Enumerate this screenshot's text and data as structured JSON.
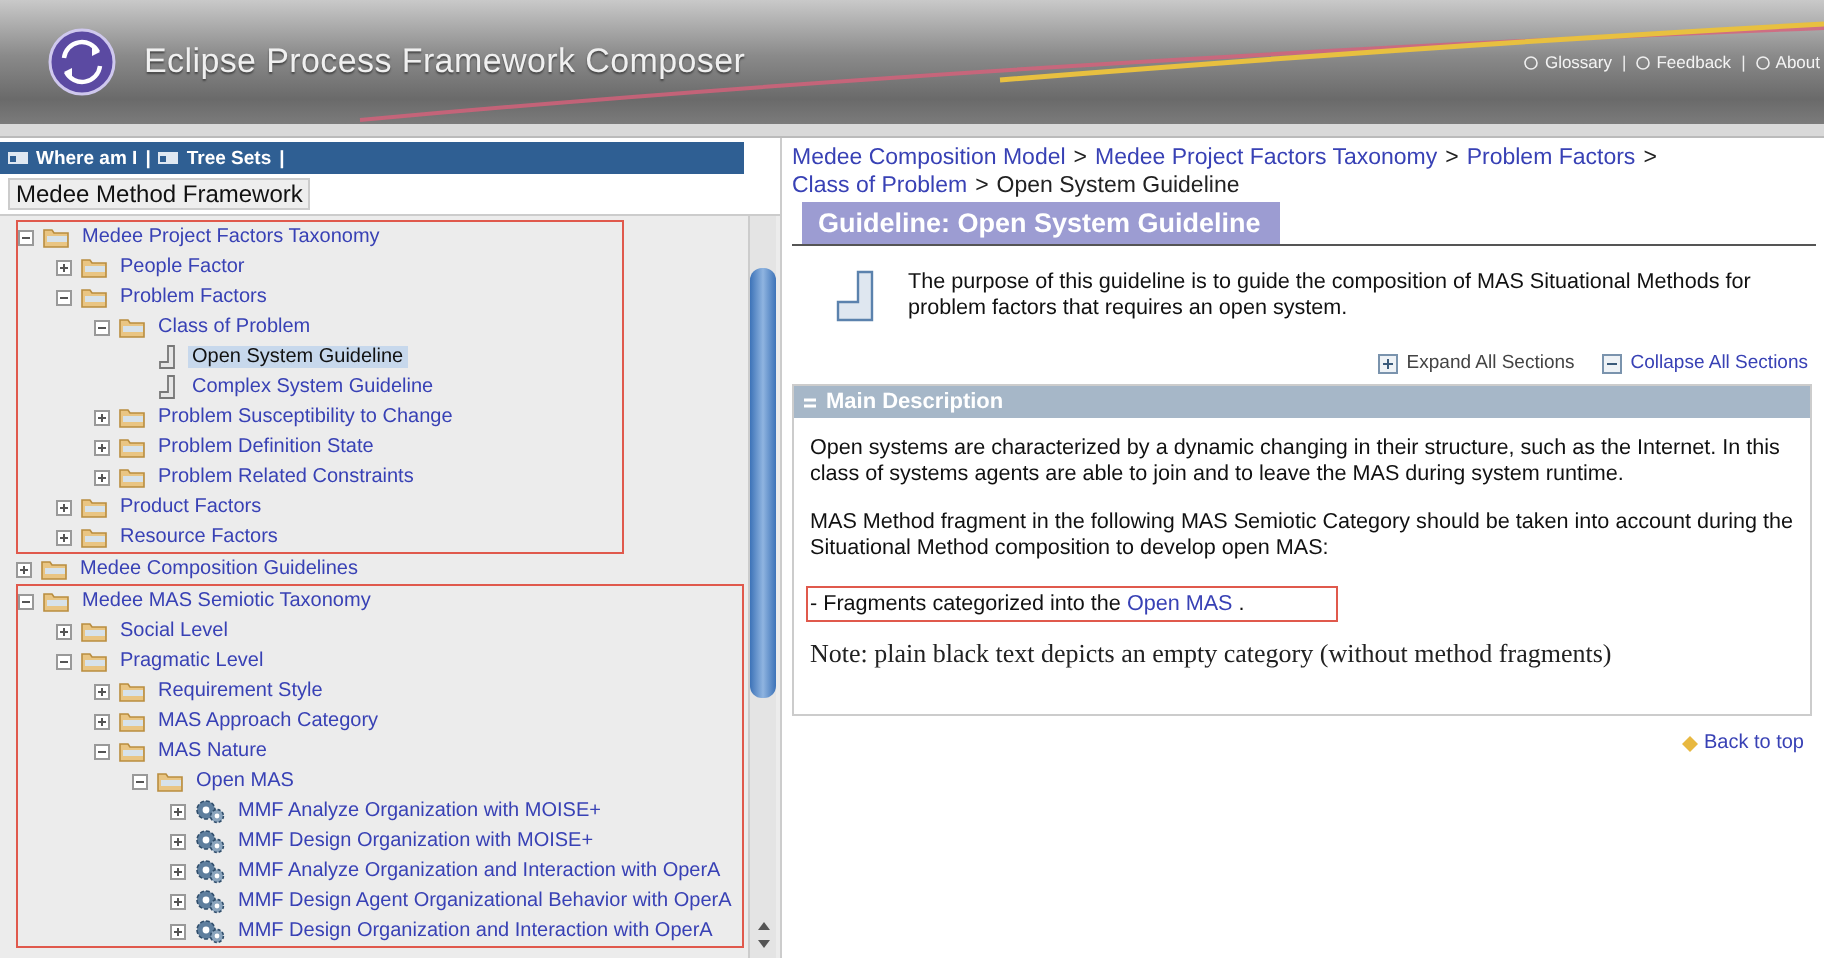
{
  "header": {
    "title": "Eclipse Process Framework Composer",
    "links": [
      {
        "kind": "link",
        "text": "Glossary"
      },
      {
        "kind": "separator",
        "text": "|"
      },
      {
        "kind": "link",
        "text": "Feedback"
      },
      {
        "kind": "separator",
        "text": "|"
      },
      {
        "kind": "link",
        "text": "About"
      }
    ]
  },
  "toolbar": [
    {
      "kind": "link",
      "text": "Where am I"
    },
    {
      "kind": "separator",
      "text": "|"
    },
    {
      "kind": "link",
      "text": "Tree Sets"
    },
    {
      "kind": "separator",
      "text": "|"
    }
  ],
  "method_framework": "Medee Method Framework",
  "tree": [
    {
      "label": "Medee Project Factors Taxonomy",
      "kind": "folder",
      "expanded": true,
      "selected": false,
      "highlighted": true,
      "children": [
        {
          "label": "People Factor",
          "kind": "folder",
          "expanded": false,
          "selected": false
        },
        {
          "label": "Problem Factors",
          "kind": "folder",
          "expanded": true,
          "selected": false,
          "children": [
            {
              "label": "Class of Problem",
              "kind": "folder",
              "expanded": true,
              "selected": false,
              "children": [
                {
                  "label": "Open System Guideline",
                  "kind": "guideline",
                  "selected": true
                },
                {
                  "label": "Complex System Guideline",
                  "kind": "guideline",
                  "selected": false
                }
              ]
            },
            {
              "label": "Problem Susceptibility to Change",
              "kind": "folder",
              "expanded": false,
              "selected": false
            },
            {
              "label": "Problem Definition State",
              "kind": "folder",
              "expanded": false,
              "selected": false
            },
            {
              "label": "Problem Related Constraints",
              "kind": "folder",
              "expanded": false,
              "selected": false
            }
          ]
        },
        {
          "label": "Product Factors",
          "kind": "folder",
          "expanded": false,
          "selected": false
        },
        {
          "label": "Resource Factors",
          "kind": "folder",
          "expanded": false,
          "selected": false
        }
      ]
    },
    {
      "label": "Medee Composition Guidelines",
      "kind": "folder",
      "expanded": false,
      "selected": false,
      "highlighted": false
    },
    {
      "label": "Medee MAS Semiotic Taxonomy",
      "kind": "folder",
      "expanded": true,
      "selected": false,
      "highlighted": true,
      "children": [
        {
          "label": "Social Level",
          "kind": "folder",
          "expanded": false,
          "selected": false
        },
        {
          "label": "Pragmatic Level",
          "kind": "folder",
          "expanded": true,
          "selected": false,
          "children": [
            {
              "label": "Requirement Style",
              "kind": "folder",
              "expanded": false,
              "selected": false
            },
            {
              "label": "MAS Approach Category",
              "kind": "folder",
              "expanded": false,
              "selected": false
            },
            {
              "label": "MAS Nature",
              "kind": "folder",
              "expanded": true,
              "selected": false,
              "children": [
                {
                  "label": "Open MAS",
                  "kind": "folder",
                  "expanded": true,
                  "selected": false,
                  "children": [
                    {
                      "label": "MMF Analyze Organization with MOISE+",
                      "kind": "fragment",
                      "expanded": false,
                      "selected": false
                    },
                    {
                      "label": "MMF Design Organization with MOISE+",
                      "kind": "fragment",
                      "expanded": false,
                      "selected": false
                    },
                    {
                      "label": "MMF Analyze Organization and Interaction with OperA",
                      "kind": "fragment",
                      "expanded": false,
                      "selected": false
                    },
                    {
                      "label": "MMF Design Agent Organizational Behavior with OperA",
                      "kind": "fragment",
                      "expanded": false,
                      "selected": false
                    },
                    {
                      "label": "MMF Design Organization and Interaction with OperA",
                      "kind": "fragment",
                      "expanded": false,
                      "selected": false
                    }
                  ]
                }
              ]
            }
          ]
        }
      ]
    }
  ],
  "breadcrumb": [
    {
      "kind": "link",
      "text": "Medee Composition Model"
    },
    {
      "kind": "separator",
      "text": ">"
    },
    {
      "kind": "link",
      "text": "Medee Project Factors Taxonomy"
    },
    {
      "kind": "separator",
      "text": ">"
    },
    {
      "kind": "link",
      "text": "Problem Factors"
    },
    {
      "kind": "separator",
      "text": ">"
    },
    {
      "kind": "link",
      "text": "Class of Problem"
    },
    {
      "kind": "separator",
      "text": ">"
    },
    {
      "kind": "current",
      "text": "Open System Guideline"
    }
  ],
  "page_title": "Guideline: Open System Guideline",
  "purpose": "The purpose of this guideline is to guide the composition of MAS Situational Methods for problem factors that requires an open system.",
  "section_controls": [
    {
      "kind": "expand",
      "text": "Expand All Sections"
    },
    {
      "kind": "collapse",
      "text": "Collapse All Sections"
    }
  ],
  "section": {
    "title": "Main Description",
    "expanded": true,
    "paragraphs": [
      "Open systems are characterized by a dynamic changing in their structure, such as the Internet. In this class of systems agents are able to join and to leave the MAS during system runtime.",
      "MAS Method fragment in the following MAS Semiotic Category should be taken into account during the Situational Method composition to develop open MAS:"
    ],
    "fragment_line": {
      "prefix": "- Fragments categorized into the ",
      "link": "Open MAS",
      "suffix": " .",
      "highlighted": true
    },
    "note": "Note: plain black text depicts an empty category (without  method fragments)"
  },
  "back_to_top": "Back to top"
}
